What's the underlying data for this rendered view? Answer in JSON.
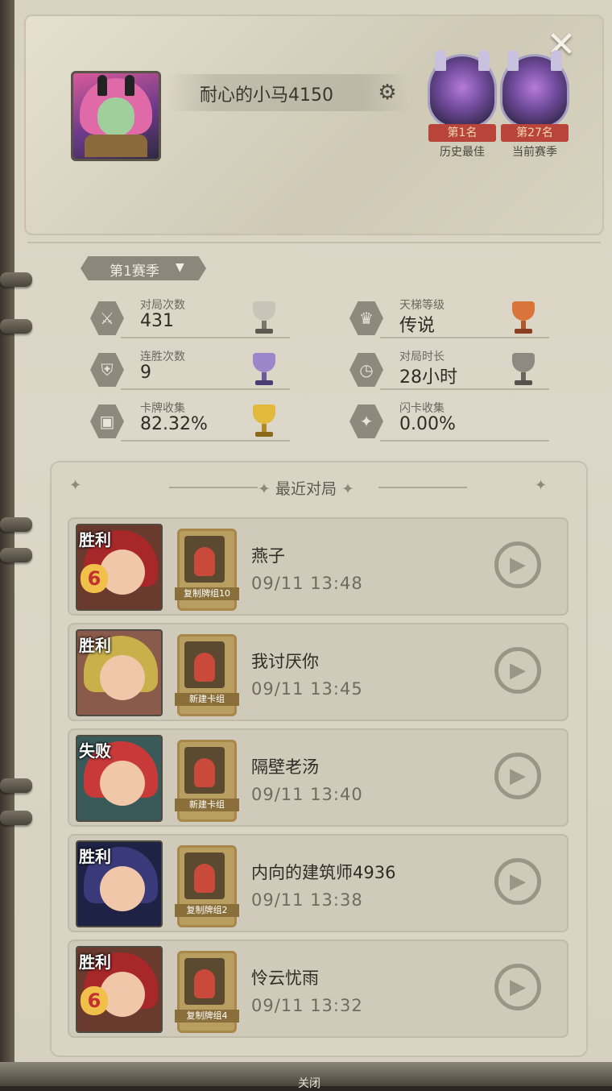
{
  "header": {
    "player_name": "耐心的小马4150",
    "close_icon": "close-icon",
    "settings_icon": "gear-icon"
  },
  "ranks": [
    {
      "ribbon": "第1名",
      "caption": "历史最佳"
    },
    {
      "ribbon": "第27名",
      "caption": "当前赛季"
    }
  ],
  "season": {
    "label": "第1赛季"
  },
  "stats": [
    {
      "label": "对局次数",
      "value": "431",
      "icon": "swords-icon",
      "trophy_color": "#c9c4b8"
    },
    {
      "label": "天梯等级",
      "value": "传说",
      "icon": "crown-icon",
      "trophy_color": "#d9743a"
    },
    {
      "label": "连胜次数",
      "value": "9",
      "icon": "shield-icon",
      "trophy_color": "#9a86c8"
    },
    {
      "label": "对局时长",
      "value": "28小时",
      "icon": "clock-icon",
      "trophy_color": "#8e8a82"
    },
    {
      "label": "卡牌收集",
      "value": "82.32%",
      "icon": "card-icon",
      "trophy_color": "#e2b93a"
    },
    {
      "label": "闪卡收集",
      "value": "0.00%",
      "icon": "sparkle-card-icon",
      "trophy_color": ""
    }
  ],
  "recent": {
    "title": "最近对局",
    "matches": [
      {
        "result": "胜利",
        "streak": "6",
        "deck": "复制牌组10",
        "opponent": "燕子",
        "time": "09/11 13:48",
        "hood": "#a8282a",
        "bg": "#6a3a2e"
      },
      {
        "result": "胜利",
        "streak": "",
        "deck": "新建卡组",
        "opponent": "我讨厌你",
        "time": "09/11 13:45",
        "hood": "#c9b04a",
        "bg": "#8a5a4a"
      },
      {
        "result": "失败",
        "streak": "",
        "deck": "新建卡组",
        "opponent": "隔壁老汤",
        "time": "09/11 13:40",
        "hood": "#c83a3a",
        "bg": "#3a5a5a"
      },
      {
        "result": "胜利",
        "streak": "",
        "deck": "复制牌组2",
        "opponent": "内向的建筑师4936",
        "time": "09/11 13:38",
        "hood": "#3a3a7a",
        "bg": "#1e2244"
      },
      {
        "result": "胜利",
        "streak": "6",
        "deck": "复制牌组4",
        "opponent": "怜云忧雨",
        "time": "09/11 13:32",
        "hood": "#a8282a",
        "bg": "#6a3a2e"
      }
    ]
  },
  "footer": {
    "text": "关闭"
  }
}
